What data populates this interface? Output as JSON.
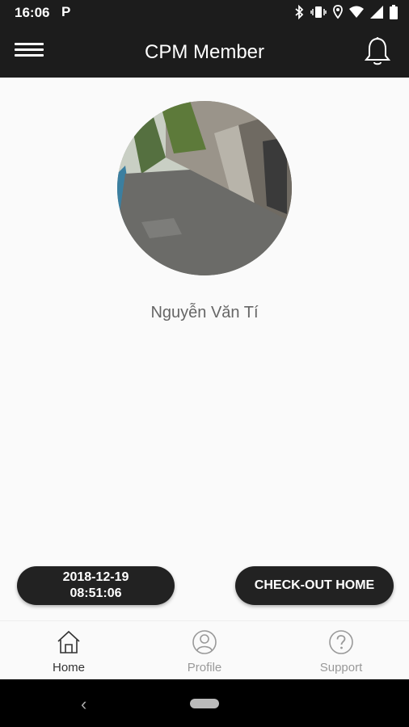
{
  "status_bar": {
    "time": "16:06",
    "p_icon": "P",
    "icons": [
      "bluetooth-icon",
      "vibrate-icon",
      "location-icon",
      "wifi-icon",
      "signal-icon",
      "battery-icon"
    ]
  },
  "app_bar": {
    "title": "CPM Member",
    "menu_icon": "hamburger-menu-icon",
    "notification_icon": "bell-icon"
  },
  "profile": {
    "avatar": "street-photo-avatar",
    "name": "Nguyễn Văn Tí"
  },
  "timestamp": {
    "date": "2018-12-19",
    "time": "08:51:06"
  },
  "actions": {
    "checkout_label": "CHECK-OUT HOME"
  },
  "bottom_nav": {
    "items": [
      {
        "label": "Home",
        "icon": "home-icon",
        "active": true
      },
      {
        "label": "Profile",
        "icon": "profile-icon",
        "active": false
      },
      {
        "label": "Support",
        "icon": "help-icon",
        "active": false
      }
    ]
  },
  "colors": {
    "bar_background": "#1c1c1c",
    "page_background": "#fafafa",
    "pill_background": "#222222",
    "inactive_nav": "#999999",
    "active_nav": "#333333"
  }
}
